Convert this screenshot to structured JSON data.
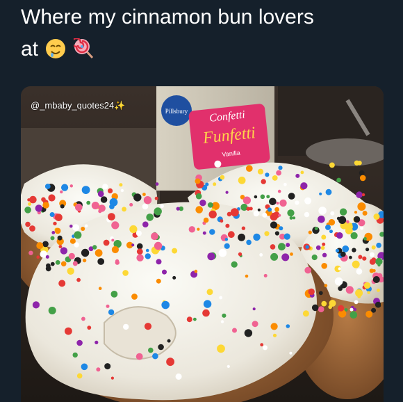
{
  "post": {
    "caption_line1": "Where my cinnamon bun lovers",
    "caption_line2": "at",
    "emojis": [
      "drooling-face-icon",
      "lollipop-icon"
    ]
  },
  "image": {
    "watermark": "@_mbaby_quotes24",
    "sparkle_icon": "sparkles-icon",
    "box_brand": "Pillsbury",
    "box_line1": "Confetti",
    "box_line2": "Funfetti",
    "box_line3": "Vanilla"
  },
  "colors": {
    "background": "#15202b",
    "text": "#ffffff"
  }
}
